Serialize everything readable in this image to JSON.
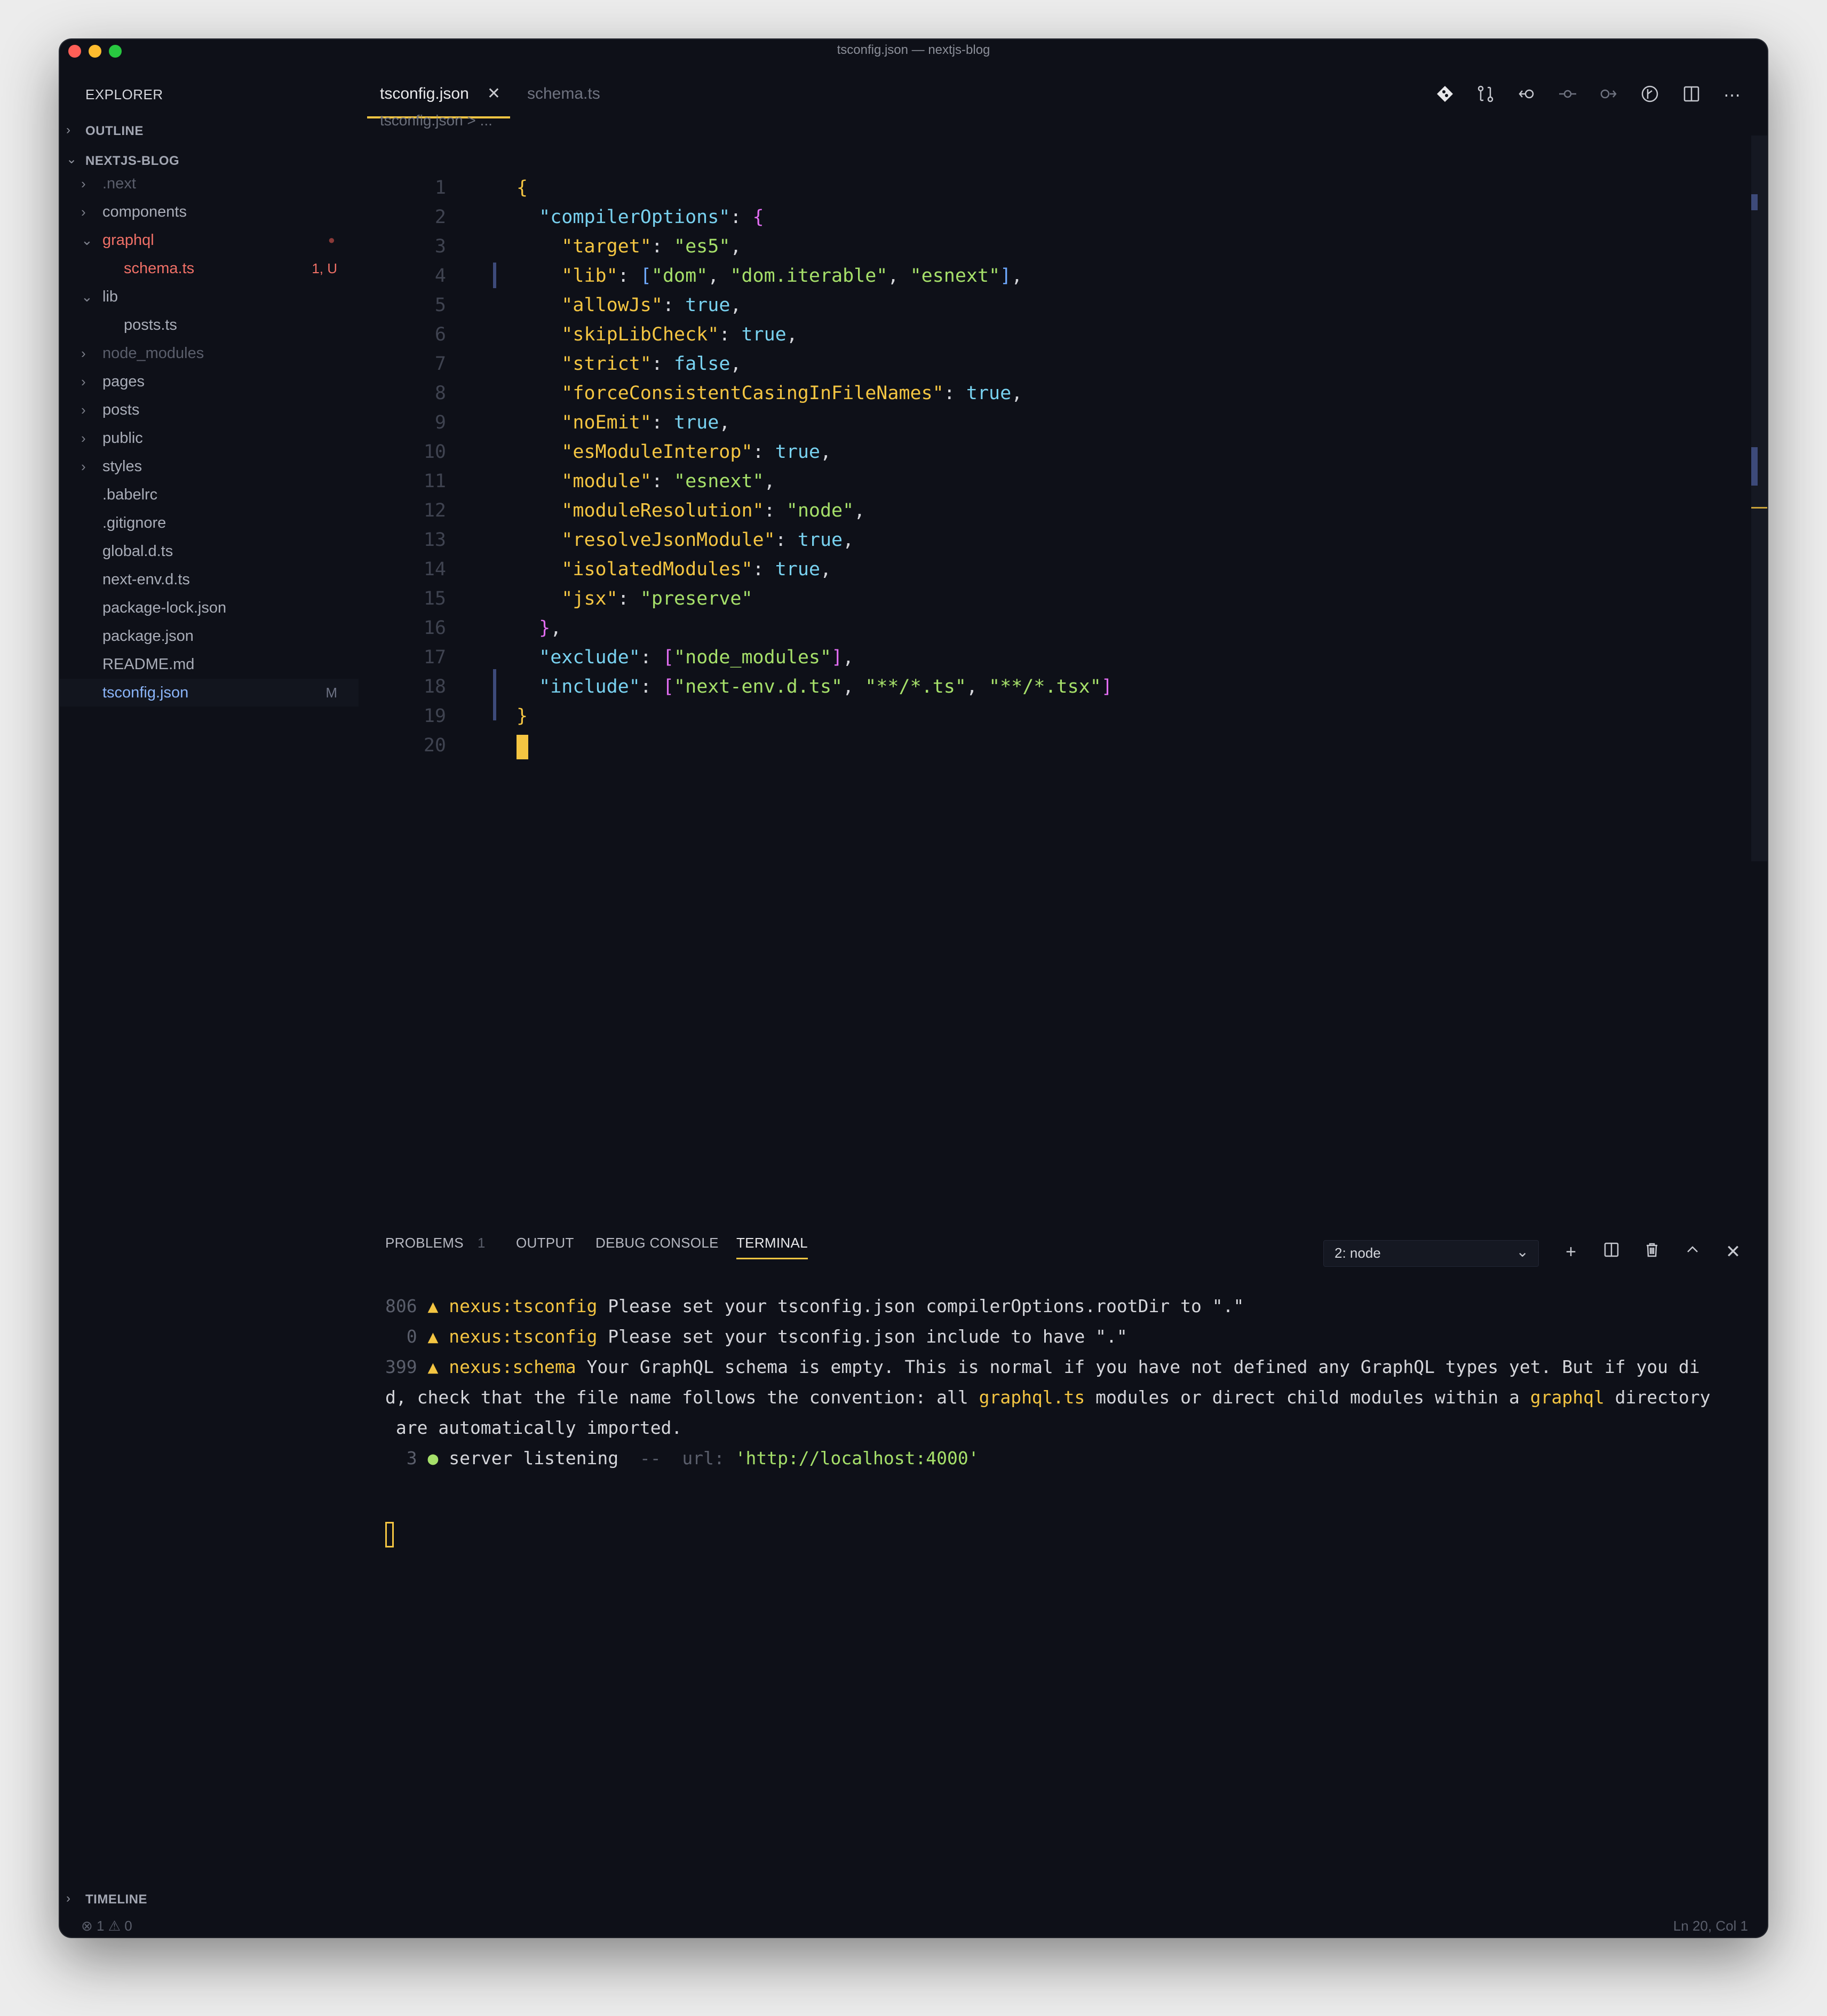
{
  "window": {
    "title": "tsconfig.json — nextjs-blog"
  },
  "sidebar": {
    "header": "EXPLORER",
    "outline_label": "OUTLINE",
    "project_label": "NEXTJS-BLOG",
    "timeline_label": "TIMELINE",
    "items": [
      {
        "label": ".next",
        "badge": ""
      },
      {
        "label": "components",
        "badge": ""
      },
      {
        "label": "graphql",
        "badge": ""
      },
      {
        "label": "schema.ts",
        "badge": "1, U"
      },
      {
        "label": "lib",
        "badge": ""
      },
      {
        "label": "posts.ts",
        "badge": ""
      },
      {
        "label": "node_modules",
        "badge": ""
      },
      {
        "label": "pages",
        "badge": ""
      },
      {
        "label": "posts",
        "badge": ""
      },
      {
        "label": "public",
        "badge": ""
      },
      {
        "label": "styles",
        "badge": ""
      },
      {
        "label": ".babelrc",
        "badge": ""
      },
      {
        "label": ".gitignore",
        "badge": ""
      },
      {
        "label": "global.d.ts",
        "badge": ""
      },
      {
        "label": "next-env.d.ts",
        "badge": ""
      },
      {
        "label": "package-lock.json",
        "badge": ""
      },
      {
        "label": "package.json",
        "badge": ""
      },
      {
        "label": "README.md",
        "badge": ""
      },
      {
        "label": "tsconfig.json",
        "badge": "M"
      }
    ]
  },
  "editor": {
    "tabs": [
      {
        "label": "tsconfig.json",
        "active": true
      },
      {
        "label": "schema.ts",
        "active": false
      }
    ],
    "breadcrumb": "tsconfig.json > ...",
    "line_numbers": [
      "1",
      "2",
      "3",
      "4",
      "5",
      "6",
      "7",
      "8",
      "9",
      "10",
      "11",
      "12",
      "13",
      "14",
      "15",
      "16",
      "17",
      "18",
      "19",
      "20"
    ],
    "code": {
      "l1_brace": "{",
      "k_compilerOptions": "\"compilerOptions\"",
      "k_target": "\"target\"",
      "v_target": "\"es5\"",
      "k_lib": "\"lib\"",
      "v_lib1": "\"dom\"",
      "v_lib2": "\"dom.iterable\"",
      "v_lib3": "\"esnext\"",
      "k_allowJs": "\"allowJs\"",
      "v_allowJs": "true",
      "k_skipLibCheck": "\"skipLibCheck\"",
      "v_skipLibCheck": "true",
      "k_strict": "\"strict\"",
      "v_strict": "false",
      "k_fcc": "\"forceConsistentCasingInFileNames\"",
      "v_fcc": "true",
      "k_noEmit": "\"noEmit\"",
      "v_noEmit": "true",
      "k_esm": "\"esModuleInterop\"",
      "v_esm": "true",
      "k_module": "\"module\"",
      "v_module": "\"esnext\"",
      "k_modres": "\"moduleResolution\"",
      "v_modres": "\"node\"",
      "k_rjm": "\"resolveJsonModule\"",
      "v_rjm": "true",
      "k_iso": "\"isolatedModules\"",
      "v_iso": "true",
      "k_jsx": "\"jsx\"",
      "v_jsx": "\"preserve\"",
      "close_inner": "}",
      "k_exclude": "\"exclude\"",
      "v_exclude": "\"node_modules\"",
      "k_include": "\"include\"",
      "v_inc1": "\"next-env.d.ts\"",
      "v_inc2": "\"**/*.ts\"",
      "v_inc3": "\"**/*.tsx\"",
      "close_outer": "}"
    }
  },
  "panel": {
    "tabs": [
      "PROBLEMS",
      "OUTPUT",
      "DEBUG CONSOLE",
      "TERMINAL"
    ],
    "problems_count": "1",
    "terminal_select": "2: node",
    "lines": {
      "n1": "806",
      "t1a": "nexus:tsconfig",
      "t1b": " Please set your tsconfig.json compilerOptions.rootDir to \".\"",
      "n2": "0",
      "t2a": "nexus:tsconfig",
      "t2b": " Please set your tsconfig.json include to have \".\"",
      "n3": "399",
      "t3a": "nexus:schema",
      "t3b": " Your GraphQL schema is empty. This is normal if you have not defined any GraphQL types yet. But if you di",
      "t4a": "d, check that the file name follows the convention: all ",
      "t4b": "graphql.ts",
      "t4c": " modules or direct child modules within a ",
      "t4d": "graphql",
      "t4e": " directory",
      "t5": " are automatically imported.",
      "n6": "3",
      "t6a": "server listening",
      "t6b": "  --  url: ",
      "t6c": "'http://localhost:4000'"
    }
  },
  "status": {
    "errors": "1",
    "warnings": "0",
    "position": "Ln 20, Col 1"
  }
}
